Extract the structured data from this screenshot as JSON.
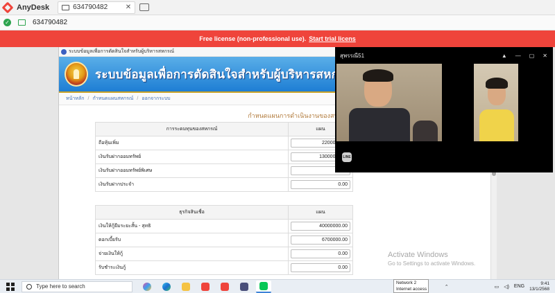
{
  "anydesk": {
    "app_name": "AnyDesk",
    "tab_label": "634790482",
    "address": "634790482",
    "license_text": "Free license (non-professional use).",
    "license_link": "Start trial licens"
  },
  "site": {
    "top_strip": "ระบบข้อมูลเพื่อการตัดสินใจสำหรับผู้บริหารสหกรณ์",
    "title": "ระบบข้อมูลเพื่อการตัดสินใจสำหรับผู้บริหารสหกรณ์",
    "breadcrumb": [
      "หน้าหลัก",
      "กำหนดแผนสหกรณ์",
      "ออกจากระบบ"
    ],
    "heading": "กำหนดแผนการดำเนินงานของสหกรณ์การเกษตรนิคมฯปราสาท จำกัด ประ"
  },
  "tables": [
    {
      "header_label": "การระดมทุนของสหกรณ์",
      "header_value": "แผน",
      "rows": [
        {
          "label": "ถือหุ้นเพิ่ม",
          "value": "2200000.00"
        },
        {
          "label": "เงินรับฝากออมทรัพย์",
          "value": "13000000.00"
        },
        {
          "label": "เงินรับฝากออมทรัพย์พิเศษ",
          "value": "0.00"
        },
        {
          "label": "เงินรับฝากประจำ",
          "value": "0.00"
        }
      ]
    },
    {
      "header_label": "ธุรกิจสินเชื่อ",
      "header_value": "แผน",
      "rows": [
        {
          "label": "เงินให้กู้ยืมระยะสั้น - สุทธิ",
          "value": "40000000.00"
        },
        {
          "label": "ดอกเบี้ยรับ",
          "value": "6700000.00"
        },
        {
          "label": "จ่ายเงินให้กู้",
          "value": "0.00"
        },
        {
          "label": "รับชำระเงินกู้",
          "value": "0.00"
        }
      ]
    }
  ],
  "activate": {
    "title": "Activate Windows",
    "subtitle": "Go to Settings to activate Windows."
  },
  "video_call": {
    "title": "สุพรรณี51",
    "badge": "LINE"
  },
  "taskbar": {
    "search_placeholder": "Type here to search",
    "network_line1": "Network  2",
    "network_line2": "Internet access",
    "language": "ENG",
    "time": "9:41",
    "date": "13/1/2568"
  },
  "colors": {
    "anydesk_red": "#ef443b",
    "site_blue": "#1e7ed4",
    "heading_brown": "#b07838"
  }
}
